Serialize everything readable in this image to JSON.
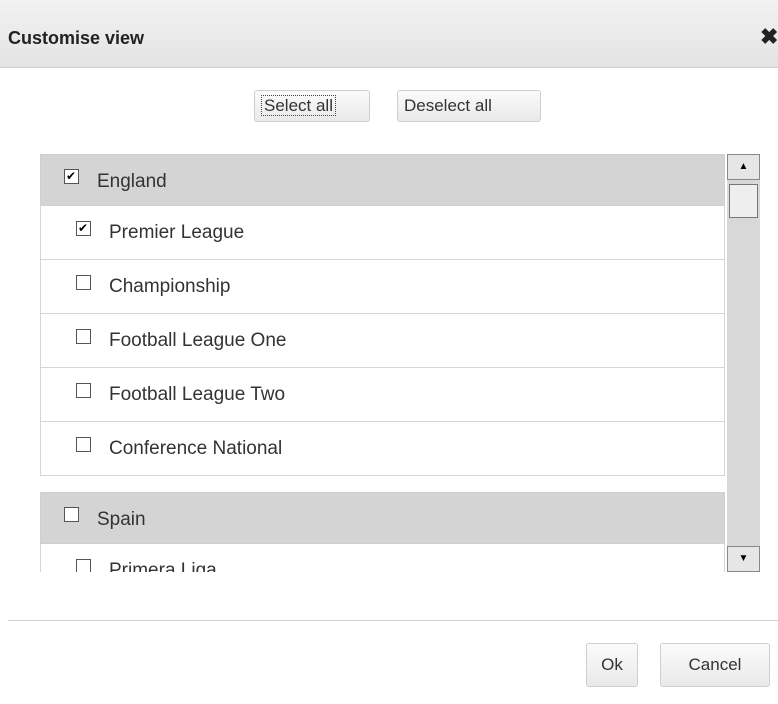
{
  "dialog": {
    "title": "Customise view",
    "close_glyph": "✖"
  },
  "actions": {
    "select_all": "Select all",
    "deselect_all": "Deselect all"
  },
  "groups": [
    {
      "name": "England",
      "checked": true,
      "items": [
        {
          "label": "Premier League",
          "checked": true
        },
        {
          "label": "Championship",
          "checked": false
        },
        {
          "label": "Football League One",
          "checked": false
        },
        {
          "label": "Football League Two",
          "checked": false
        },
        {
          "label": "Conference National",
          "checked": false
        }
      ]
    },
    {
      "name": "Spain",
      "checked": false,
      "items": [
        {
          "label": "Primera Liga",
          "checked": false
        }
      ]
    }
  ],
  "footer": {
    "ok": "Ok",
    "cancel": "Cancel"
  }
}
